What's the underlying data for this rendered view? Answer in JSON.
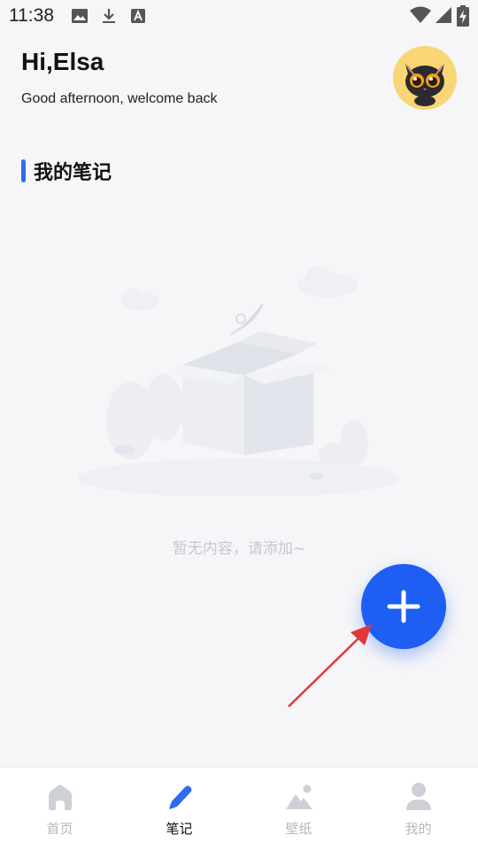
{
  "status_bar": {
    "time": "11:38",
    "left_icons": [
      "image-icon",
      "download-icon",
      "font-icon"
    ],
    "right_icons": [
      "wifi-icon",
      "signal-icon",
      "battery-charging-icon"
    ]
  },
  "header": {
    "greeting": "Hi,Elsa",
    "subtitle": "Good afternoon, welcome back",
    "avatar_icon": "black-cat-avatar"
  },
  "notes_section": {
    "title": "我的笔记",
    "empty_text": "暂无内容，请添加~",
    "empty_icon": "empty-box-illustration"
  },
  "fab": {
    "icon": "plus-icon",
    "color": "#1f5ef3"
  },
  "bottom_nav": {
    "items": [
      {
        "label": "首页",
        "icon": "home-icon",
        "active": false
      },
      {
        "label": "笔记",
        "icon": "pen-icon",
        "active": true
      },
      {
        "label": "壁纸",
        "icon": "mountain-image-icon",
        "active": false
      },
      {
        "label": "我的",
        "icon": "person-icon",
        "active": false
      }
    ]
  },
  "colors": {
    "accent": "#2f6bf0",
    "background": "#f6f6f8",
    "inactive_nav": "#b5b7bd",
    "annotation_arrow": "#e0383a"
  }
}
